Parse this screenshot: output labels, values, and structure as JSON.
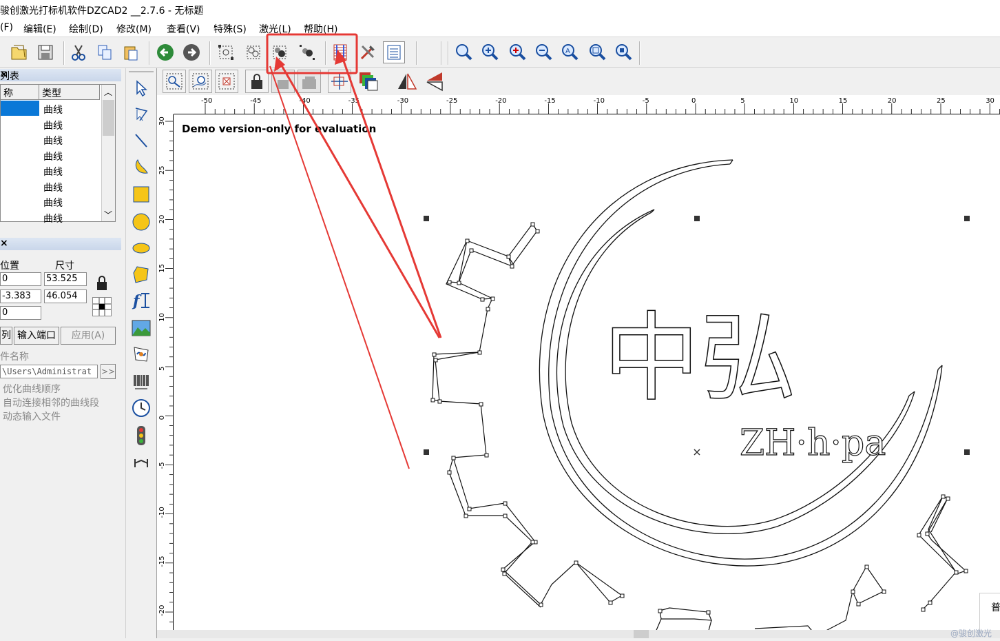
{
  "window": {
    "title": "骏创激光打标机软件DZCAD2 __2.7.6 - 无标题"
  },
  "menu": [
    {
      "label": "(F)"
    },
    {
      "label": "编辑(E)"
    },
    {
      "label": "绘制(D)"
    },
    {
      "label": "修改(M)"
    },
    {
      "label": "查看(V)"
    },
    {
      "label": "特殊(S)"
    },
    {
      "label": "激光(L)"
    },
    {
      "label": "帮助(H)"
    }
  ],
  "toolbar1": {
    "icons": [
      "open-folder-icon",
      "save-disk-icon",
      "cut-scissors-icon",
      "copy-icon",
      "paste-icon",
      "back-arrow-icon",
      "forward-arrow-icon",
      "select-nodes-icon",
      "select-points-icon",
      "group-icon",
      "ungroup-icon",
      "hatch-icon",
      "tools-icon",
      "parameter-list-icon",
      "zoom-icon",
      "zoom-in-icon",
      "zoom-plus-icon",
      "zoom-minus-icon",
      "zoom-all-icon",
      "zoom-selected-icon",
      "zoom-window-icon"
    ],
    "highlight_color": "#e53935"
  },
  "object_list": {
    "header": "列表",
    "columns": [
      "称",
      "类型"
    ],
    "rows": [
      "曲线",
      "曲线",
      "曲线",
      "曲线",
      "曲线",
      "曲线",
      "曲线",
      "曲线"
    ]
  },
  "properties": {
    "col_position": "位置",
    "col_size": "尺寸",
    "pos_x": "0",
    "pos_y": "-3.383",
    "pos_z": "0",
    "size_w": "53.525",
    "size_h": "46.054",
    "btn_left": "列",
    "btn_input_port": "输入端口",
    "btn_apply": "应用(A)",
    "file_name_label": "件名称",
    "file_path": "\\Users\\Administrat",
    "browse": ">>",
    "opt1": "优化曲线顺序",
    "opt2": "自动连接相邻的曲线段",
    "opt3": "动态输入文件"
  },
  "canvas": {
    "demo_text": "Demo version-only for evaluation",
    "ruler_top_labels": [
      "-50",
      "-45",
      "-40",
      "-35",
      "-30",
      "-25",
      "-20",
      "-15",
      "-10",
      "-5",
      "0",
      "5",
      "10",
      "15",
      "20",
      "25",
      "30"
    ],
    "ruler_left_labels": [
      "30",
      "25",
      "20",
      "15",
      "10",
      "5",
      "0",
      "-5",
      "-10",
      "-15",
      "-20"
    ],
    "logo_text_cn": "中弘",
    "logo_text_en": "ZH·h·pa",
    "corner_text": "普"
  },
  "watermark": "@骏创激光"
}
